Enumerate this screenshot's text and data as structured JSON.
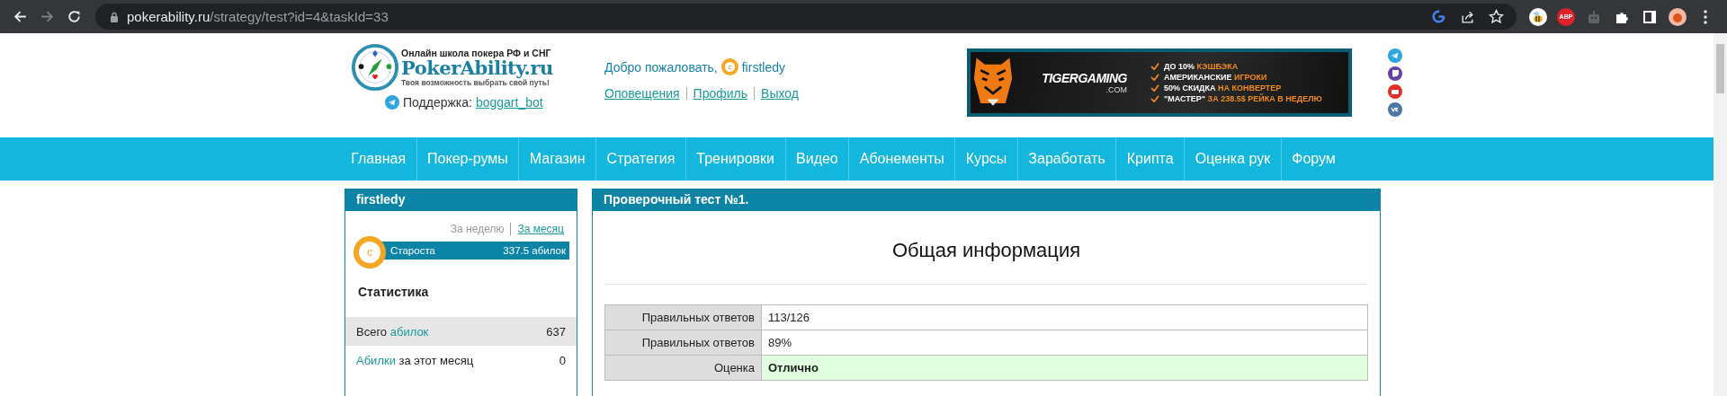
{
  "browser": {
    "url_host": "pokerability.ru",
    "url_path": "/strategy/test?id=4&taskId=33",
    "abp_label": "ABP"
  },
  "header": {
    "logo": {
      "tagline": "Онлайн школа покера РФ и СНГ",
      "name": "PokerAbility.ru",
      "slogan": "Твоя возможность выбрать свой путь!"
    },
    "support": {
      "label": "Поддержка:",
      "link": "boggart_bot"
    },
    "welcome": {
      "text": "Добро пожаловать,",
      "chip": "c",
      "user": "firstledy",
      "links": [
        "Оповещения",
        "Профиль",
        "Выход"
      ]
    },
    "banner": {
      "brand": "TIGERGAMING",
      "brand_sub": ".COM",
      "lines": [
        {
          "white": "ДО 10%",
          "orange": "КЭШБЭКА"
        },
        {
          "white": "АМЕРИКАНСКИЕ",
          "orange": "ИГРОКИ"
        },
        {
          "white": "50% СКИДКА",
          "orange": "НА КОНВЕРТЕР"
        },
        {
          "white": "\"МАСТЕР\"",
          "orange": "ЗА 238.5$ РЕЙКА В НЕДЕЛЮ"
        }
      ]
    }
  },
  "nav": [
    "Главная",
    "Покер-румы",
    "Магазин",
    "Стратегия",
    "Тренировки",
    "Видео",
    "Абонементы",
    "Курсы",
    "Заработать",
    "Крипта",
    "Оценка рук",
    "Форум"
  ],
  "sidebar": {
    "title": "firstledy",
    "periods": [
      {
        "label": "За неделю",
        "selected": true
      },
      {
        "label": "За месяц",
        "selected": false
      }
    ],
    "rank": {
      "badge": "c",
      "name": "Староста",
      "value": "337.5 абилок"
    },
    "stats_title": "Статистика",
    "stats": [
      {
        "parts": [
          {
            "text": "Всего",
            "link": false
          },
          {
            "text": "абилок",
            "link": true
          }
        ],
        "value": "637",
        "selected": true
      },
      {
        "parts": [
          {
            "text": "Абилки",
            "link": true
          },
          {
            "text": "за этот месяц",
            "link": false
          }
        ],
        "value": "0",
        "selected": false
      }
    ]
  },
  "content": {
    "title": "Проверочный тест №1.",
    "heading": "Общая информация",
    "rows": [
      {
        "label": "Правильных ответов",
        "value": "113/126",
        "kind": "plain"
      },
      {
        "label": "Правильных ответов",
        "value": "89%",
        "kind": "plain"
      },
      {
        "label": "Оценка",
        "value": "Отлично",
        "kind": "grade"
      }
    ]
  }
}
